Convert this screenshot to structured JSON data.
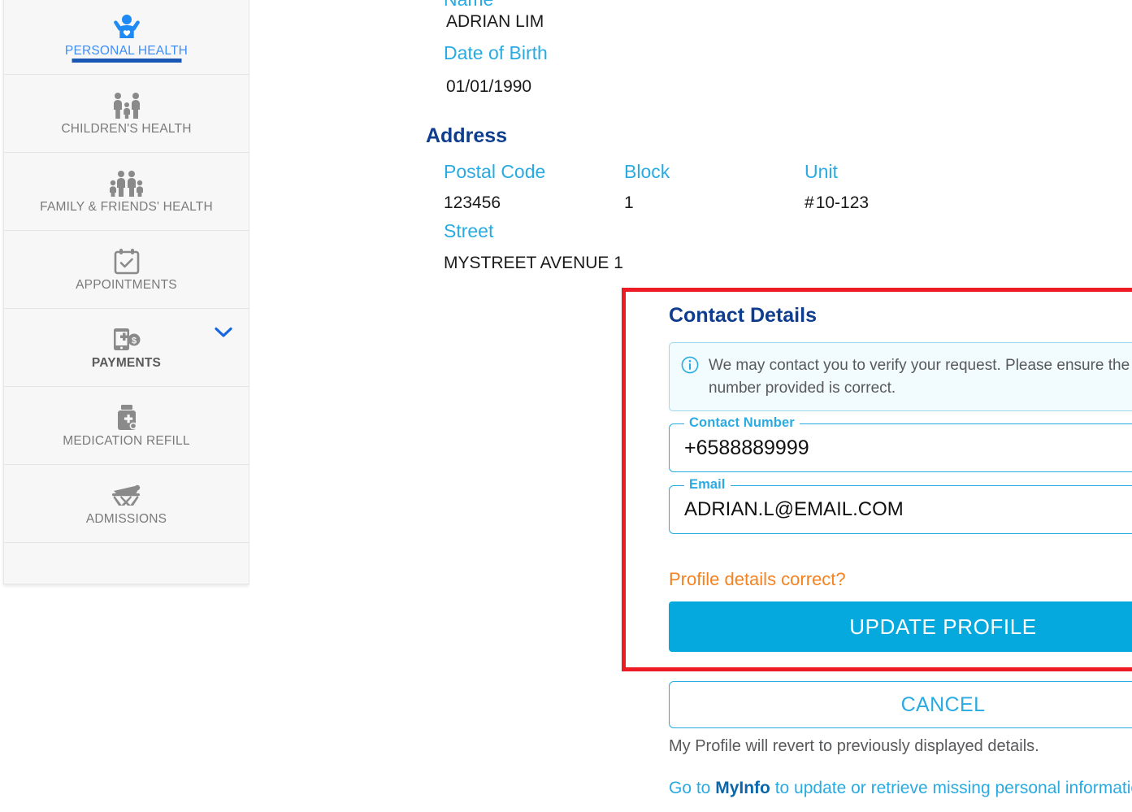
{
  "sidebar": {
    "items": [
      {
        "label": "PERSONAL HEALTH",
        "icon": "person-raised-arms-heart-icon",
        "state": "active"
      },
      {
        "label": "CHILDREN'S HEALTH",
        "icon": "two-adults-child-icon",
        "state": "normal"
      },
      {
        "label": "FAMILY & FRIENDS' HEALTH",
        "icon": "family-group-icon",
        "state": "normal"
      },
      {
        "label": "APPOINTMENTS",
        "icon": "calendar-check-icon",
        "state": "normal"
      },
      {
        "label": "PAYMENTS",
        "icon": "mobile-payment-icon",
        "state": "selected",
        "expander": "chevron-down-icon"
      },
      {
        "label": "MEDICATION REFILL",
        "icon": "medicine-bottle-icon",
        "state": "normal"
      },
      {
        "label": "ADMISSIONS",
        "icon": "hospital-bed-icon",
        "state": "normal"
      }
    ]
  },
  "profile": {
    "name_label": "Name",
    "name_value": "ADRIAN LIM",
    "dob_label": "Date of Birth",
    "dob_value": "01/01/1990"
  },
  "address": {
    "heading": "Address",
    "postal_label": "Postal Code",
    "postal_value": "123456",
    "block_label": "Block",
    "block_value": "1",
    "unit_label": "Unit",
    "unit_hash": "#",
    "unit_value": "10-123",
    "street_label": "Street",
    "street_value": "MYSTREET AVENUE 1"
  },
  "contact": {
    "heading": "Contact Details",
    "info_icon": "info-circle-icon",
    "info_text": "We may contact you to verify your request. Please ensure the contact number provided is correct.",
    "number_label": "Contact Number",
    "number_value": "+6588889999",
    "number_placeholder": "Contact Number",
    "email_label": "Email",
    "email_value": "ADRIAN.L@EMAIL.COM",
    "email_placeholder": "Email",
    "prompt": "Profile details correct?",
    "update_button": "UPDATE PROFILE"
  },
  "footer": {
    "cancel_button": "CANCEL",
    "revert_note": "My Profile will revert to previously displayed details.",
    "myinfo_prefix": "Go to ",
    "myinfo_link": "MyInfo",
    "myinfo_suffix": " to update or retrieve missing personal information."
  },
  "colors": {
    "accent_blue": "#29ABE2",
    "primary_button": "#05A9DD",
    "heading_navy": "#0d3d8c",
    "highlight_red": "#ED1C24",
    "prompt_orange": "#F58220",
    "active_bar_blue": "#1a57b5"
  }
}
